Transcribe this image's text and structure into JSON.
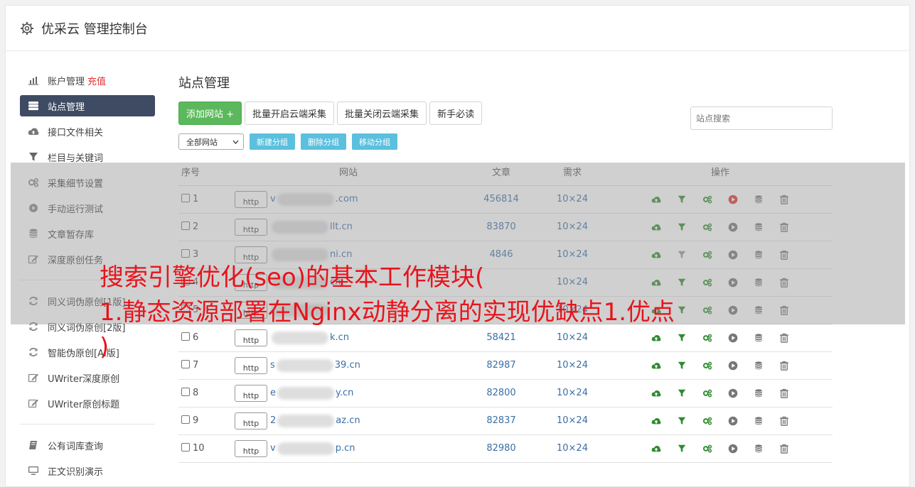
{
  "header": {
    "title": "优采云 管理控制台"
  },
  "sidebar": {
    "items": [
      {
        "label": "账户管理",
        "badge": "充值",
        "icon": "bar-chart-icon"
      },
      {
        "label": "站点管理",
        "icon": "server-icon",
        "active": true
      },
      {
        "label": "接口文件相关",
        "icon": "cloud-upload-icon"
      },
      {
        "label": "栏目与关键词",
        "icon": "filter-icon"
      },
      {
        "label": "采集细节设置",
        "icon": "gears-icon"
      },
      {
        "label": "手动运行测试",
        "icon": "play-circle-icon"
      },
      {
        "label": "文章暂存库",
        "icon": "database-icon"
      },
      {
        "label": "深度原创任务",
        "icon": "edit-icon"
      }
    ],
    "items2": [
      {
        "label": "同义词伪原创[1版]",
        "icon": "refresh-icon"
      },
      {
        "label": "同义词伪原创[2版]",
        "icon": "refresh-icon"
      },
      {
        "label": "智能伪原创[AI版]",
        "icon": "refresh-icon"
      },
      {
        "label": "UWriter深度原创",
        "icon": "edit-icon"
      },
      {
        "label": "UWriter原创标题",
        "icon": "edit-icon"
      }
    ],
    "items3": [
      {
        "label": "公有词库查询",
        "icon": "book-icon"
      },
      {
        "label": "正文识别演示",
        "icon": "monitor-icon"
      }
    ]
  },
  "main": {
    "title": "站点管理",
    "toolbar": {
      "add": "添加网站 +",
      "batch_open": "批量开启云端采集",
      "batch_close": "批量关闭云端采集",
      "guide": "新手必读"
    },
    "search_placeholder": "站点搜索",
    "group_select": "全部网站",
    "group_buttons": {
      "new": "新建分组",
      "delete": "删除分组",
      "move": "移动分组"
    },
    "table": {
      "headers": {
        "no": "序号",
        "site": "网站",
        "articles": "文章",
        "demand": "需求",
        "ops": "操作"
      },
      "rows": [
        {
          "no": "1",
          "http": "http",
          "pre": "v",
          "post": ".com",
          "articles": "456814",
          "demand": "10×24",
          "active": true
        },
        {
          "no": "2",
          "http": "http",
          "pre": "",
          "post": "llt.cn",
          "articles": "83870",
          "demand": "10×24"
        },
        {
          "no": "3",
          "http": "http",
          "pre": "",
          "post": "ni.cn",
          "articles": "4846",
          "demand": "10×24"
        },
        {
          "no": "4",
          "http": "http",
          "pre": "",
          "post": "cn",
          "articles": "",
          "demand": "10×24"
        },
        {
          "no": "5",
          "http": "http",
          "pre": "",
          "post": "",
          "articles": "",
          "demand": "10×24"
        },
        {
          "no": "6",
          "http": "http",
          "pre": "",
          "post": "k.cn",
          "articles": "58421",
          "demand": "10×24"
        },
        {
          "no": "7",
          "http": "http",
          "pre": "s",
          "post": "39.cn",
          "articles": "82987",
          "demand": "10×24"
        },
        {
          "no": "8",
          "http": "http",
          "pre": "e",
          "post": "y.cn",
          "articles": "82800",
          "demand": "10×24"
        },
        {
          "no": "9",
          "http": "http",
          "pre": "2",
          "post": "az.cn",
          "articles": "82837",
          "demand": "10×24"
        },
        {
          "no": "10",
          "http": "http",
          "pre": "v",
          "post": "p.cn",
          "articles": "82980",
          "demand": "10×24"
        }
      ]
    }
  },
  "overlay": {
    "line1": "搜索引擎优化(seo)的基本工作模块(",
    "line2": "1.静态资源部署在Nginx动静分离的实现优缺点1.优点",
    "line3": ")"
  },
  "colors": {
    "accent": "#3e4b63",
    "green": "#5cb85c",
    "info": "#5bc0de",
    "link": "#3a6ea5",
    "headline": "#e8141c"
  }
}
